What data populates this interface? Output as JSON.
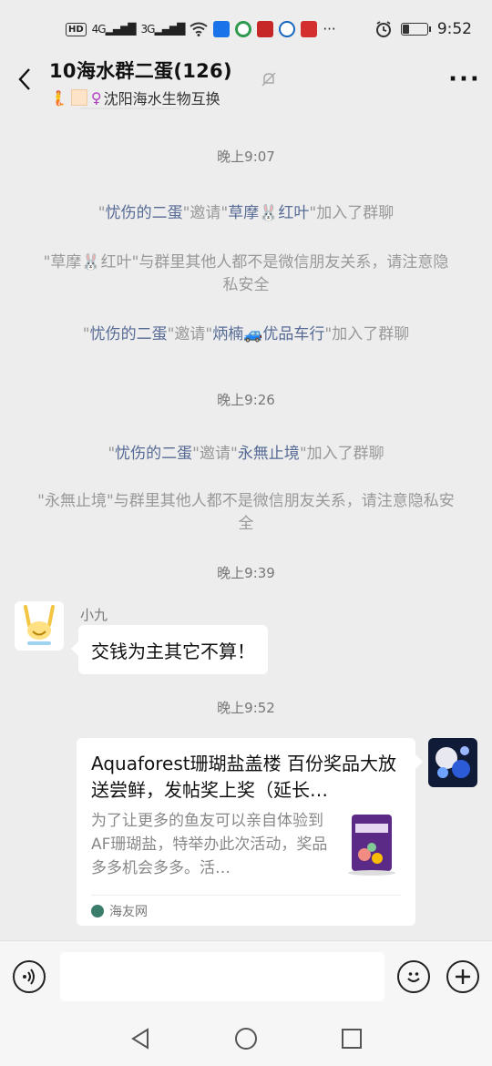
{
  "status_bar": {
    "left_chip": "HD",
    "sig1": "4G",
    "sig2": "3G",
    "dots": "···",
    "time": "9:52",
    "battery_fraction": 0.25
  },
  "header": {
    "title": "10海水群二蛋(126)",
    "subtitle": "沈阳海水生物互换",
    "more_glyph": "···"
  },
  "messages": {
    "time1": "晚上9:07",
    "sys1": {
      "q1": "\"",
      "name1": "忧伤的二蛋",
      "mid": "\"邀请\"",
      "name2": "草摩🐰红叶",
      "end": "\"加入了群聊"
    },
    "sys2": "\"草摩🐰红叶\"与群里其他人都不是微信朋友关系，请注意隐私安全",
    "sys3": {
      "q1": "\"",
      "name1": "忧伤的二蛋",
      "mid": "\"邀请\"",
      "name2": "炳楠🚙优品车行",
      "end": "\"加入了群聊"
    },
    "time2": "晚上9:26",
    "sys4": {
      "q1": "\"",
      "name1": "忧伤的二蛋",
      "mid": "\"邀请\"",
      "name2": "永無止境",
      "end": "\"加入了群聊"
    },
    "sys5": "\"永無止境\"与群里其他人都不是微信朋友关系，请注意隐私安全",
    "time3": "晚上9:39",
    "msg1": {
      "sender": "小九",
      "text": "交钱为主其它不算！"
    },
    "time4": "晚上9:52",
    "card": {
      "title": "Aquaforest珊瑚盐盖楼 百份奖品大放送尝鲜，发帖奖上奖（延长…",
      "desc": "为了让更多的鱼友可以亲自体验到AF珊瑚盐，特举办此次活动，奖品多多机会多多。活…",
      "source": "海友网"
    }
  },
  "input_bar": {
    "voice_icon": "voice-icon",
    "emoji_icon": "emoji-icon",
    "plus_icon": "plus-icon"
  },
  "colors": {
    "link": "#576b95",
    "background": "#ededed"
  }
}
